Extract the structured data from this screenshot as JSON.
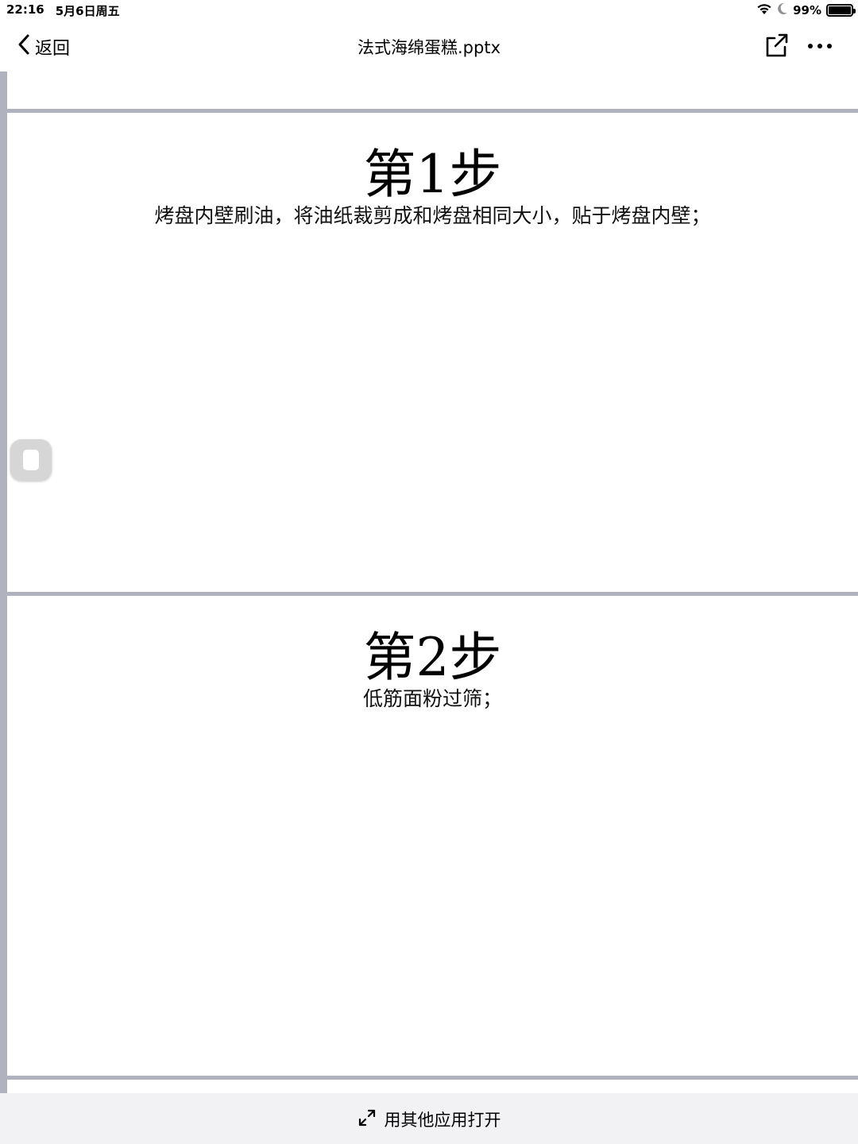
{
  "status_bar": {
    "time": "22:16",
    "date": "5月6日周五",
    "battery": "99%",
    "battery_level": 0.99,
    "icons": [
      "wifi-icon",
      "moon-icon",
      "battery-icon"
    ]
  },
  "nav": {
    "back_label": "返回",
    "title": "法式海绵蛋糕.pptx",
    "icons": [
      "chevron-left-icon",
      "share-icon",
      "more-icon"
    ]
  },
  "slides": [
    {
      "title": "第1步",
      "body": "烤盘内壁刷油，将油纸裁剪成和烤盘相同大小，贴于烤盘内壁；"
    },
    {
      "title": "第2步",
      "body": "低筋面粉过筛；"
    }
  ],
  "bottom_bar": {
    "open_with_label": "用其他应用打开",
    "icon": "expand-icon"
  }
}
